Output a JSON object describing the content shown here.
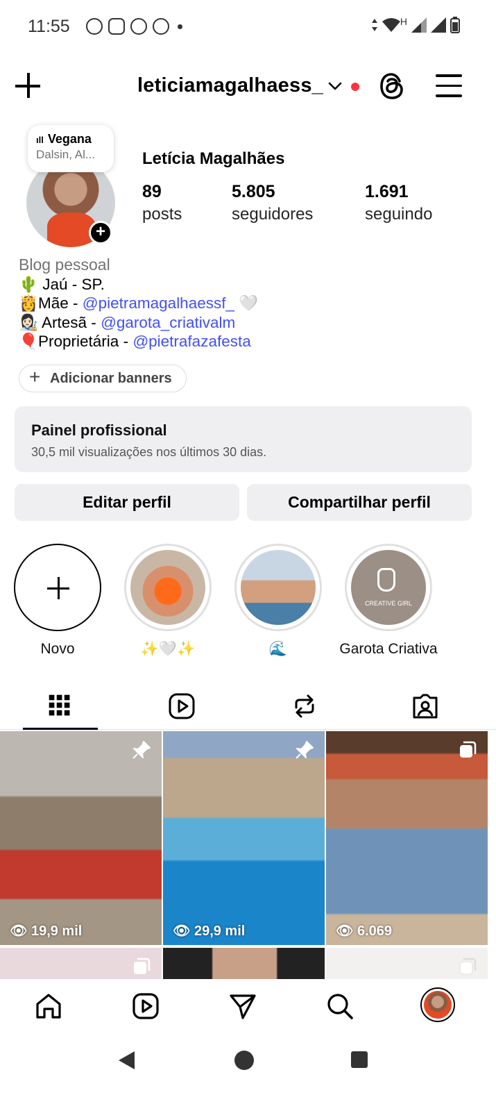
{
  "status_bar": {
    "time": "11:55",
    "network_label": "H"
  },
  "header": {
    "username": "leticiamagalhaess_"
  },
  "note": {
    "title": "Vegana",
    "subtitle": "Dalsin, Al..."
  },
  "profile": {
    "full_name": "Letícia Magalhães",
    "stats": [
      {
        "value": "89",
        "label": "posts"
      },
      {
        "value": "5.805",
        "label": "seguidores"
      },
      {
        "value": "1.691",
        "label": "seguindo"
      }
    ],
    "bio": {
      "category": "Blog pessoal",
      "line1": "🌵 Jaú - SP.",
      "line2_prefix": "👸Mãe - ",
      "line2_link": "@pietramagalhaessf_",
      "line2_suffix": " 🤍",
      "line3_prefix": "👩🏻‍🎨 Artesã - ",
      "line3_link": "@garota_criativalm",
      "line4_prefix": "🎈Proprietária - ",
      "line4_link": "@pietrafazafesta"
    },
    "add_banners": "Adicionar banners"
  },
  "pro_panel": {
    "title": "Painel profissional",
    "subtitle": "30,5 mil visualizações nos últimos 30 dias."
  },
  "buttons": {
    "edit": "Editar perfil",
    "share": "Compartilhar perfil"
  },
  "highlights": [
    {
      "label": "Novo"
    },
    {
      "label": "✨🤍✨"
    },
    {
      "label": "🌊"
    },
    {
      "label": "Garota Criativa"
    }
  ],
  "highlight_art": {
    "creative_text": "CREATIVE GIRL"
  },
  "posts": [
    {
      "views": "19,9 mil",
      "badge": "pin-icon"
    },
    {
      "views": "29,9 mil",
      "badge": "pin-icon"
    },
    {
      "views": "6.069",
      "badge": "carousel-icon"
    }
  ],
  "colors": {
    "link": "#4150f7",
    "notification_dot": "#ff3040",
    "panel_bg": "#efeff2"
  }
}
